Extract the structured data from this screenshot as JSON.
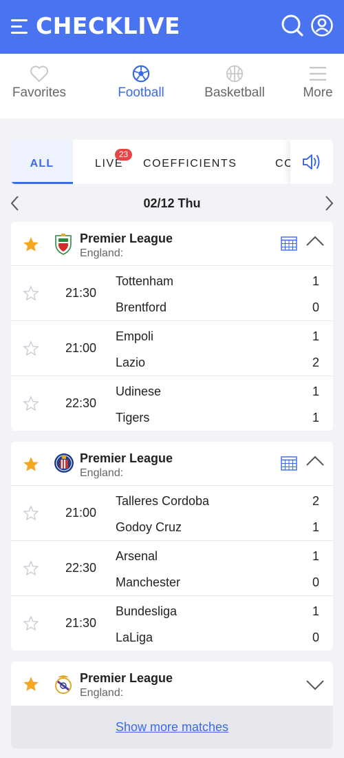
{
  "app": {
    "title": "CHECKLIVE"
  },
  "nav": [
    {
      "label": "Favorites",
      "icon": "heart-icon"
    },
    {
      "label": "Football",
      "icon": "football-icon",
      "active": true
    },
    {
      "label": "Basketball",
      "icon": "basketball-icon"
    },
    {
      "label": "More",
      "icon": "more-icon"
    }
  ],
  "tabs": [
    {
      "label": "ALL",
      "active": true
    },
    {
      "label": "LIVE",
      "badge": "23"
    },
    {
      "label": "COEFFICIENTS"
    },
    {
      "label": "CO"
    }
  ],
  "date": "02/12 Thu",
  "leagues": [
    {
      "name": "Premier League",
      "country": "England:",
      "crest": "elche-crest-icon",
      "favorite": true,
      "expanded": true,
      "matches": [
        {
          "time": "21:30",
          "home": "Tottenham",
          "away": "Brentford",
          "home_score": "1",
          "away_score": "0"
        },
        {
          "time": "21:00",
          "home": "Empoli",
          "away": "Lazio",
          "home_score": "1",
          "away_score": "2"
        },
        {
          "time": "22:30",
          "home": "Udinese",
          "away": "Tigers",
          "home_score": "1",
          "away_score": "1"
        }
      ]
    },
    {
      "name": "Premier League",
      "country": "England:",
      "crest": "getafe-crest-icon",
      "favorite": true,
      "expanded": true,
      "matches": [
        {
          "time": "21:00",
          "home": "Talleres Cordoba",
          "away": "Godoy Cruz",
          "home_score": "2",
          "away_score": "1"
        },
        {
          "time": "22:30",
          "home": "Arsenal",
          "away": "Manchester",
          "home_score": "1",
          "away_score": "0"
        },
        {
          "time": "21:30",
          "home": "Bundesliga",
          "away": "LaLiga",
          "home_score": "1",
          "away_score": "0"
        }
      ]
    },
    {
      "name": "Premier League",
      "country": "England:",
      "crest": "real-madrid-crest-icon",
      "favorite": true,
      "expanded": false,
      "matches": []
    }
  ],
  "show_more": "Show more matches",
  "colors": {
    "brand": "#4a73f0",
    "accent": "#3a6ae6",
    "star": "#f5a623",
    "badge": "#e94444"
  }
}
